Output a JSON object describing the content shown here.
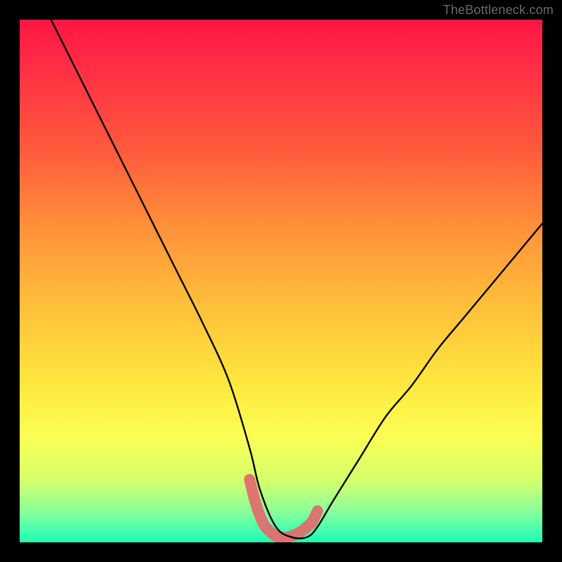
{
  "watermark": "TheBottleneck.com",
  "chart_data": {
    "type": "line",
    "title": "",
    "xlabel": "",
    "ylabel": "",
    "xlim": [
      0,
      100
    ],
    "ylim": [
      0,
      100
    ],
    "grid": false,
    "legend": false,
    "series": [
      {
        "name": "black-curve",
        "color": "#000000",
        "x": [
          6,
          10,
          15,
          20,
          25,
          30,
          35,
          40,
          44,
          46,
          49,
          52,
          55,
          57,
          60,
          65,
          70,
          75,
          80,
          85,
          90,
          95,
          100
        ],
        "values": [
          100,
          92,
          82,
          72,
          62,
          52,
          42,
          31,
          18,
          10,
          3,
          1,
          1,
          3,
          8,
          16,
          24,
          30,
          37,
          43,
          49,
          55,
          61
        ]
      },
      {
        "name": "highlight-band",
        "color": "#e06e6e",
        "x": [
          44,
          45,
          46,
          47,
          48,
          49,
          50,
          51,
          52,
          53,
          54,
          55,
          56,
          57
        ],
        "values": [
          12,
          8,
          5,
          3,
          2,
          1.2,
          1,
          1,
          1.2,
          1.6,
          2.2,
          3.0,
          4.0,
          6.0
        ]
      }
    ],
    "background_gradient": {
      "stops": [
        {
          "pos": 0.0,
          "color": "#ff1542"
        },
        {
          "pos": 0.08,
          "color": "#ff2b46"
        },
        {
          "pos": 0.25,
          "color": "#ff5a3c"
        },
        {
          "pos": 0.4,
          "color": "#ff923a"
        },
        {
          "pos": 0.55,
          "color": "#ffc03a"
        },
        {
          "pos": 0.7,
          "color": "#ffe83e"
        },
        {
          "pos": 0.8,
          "color": "#faff55"
        },
        {
          "pos": 0.88,
          "color": "#d6ff6b"
        },
        {
          "pos": 0.94,
          "color": "#8bff9a"
        },
        {
          "pos": 0.98,
          "color": "#3fffb0"
        },
        {
          "pos": 1.0,
          "color": "#1bffb3"
        }
      ]
    }
  }
}
